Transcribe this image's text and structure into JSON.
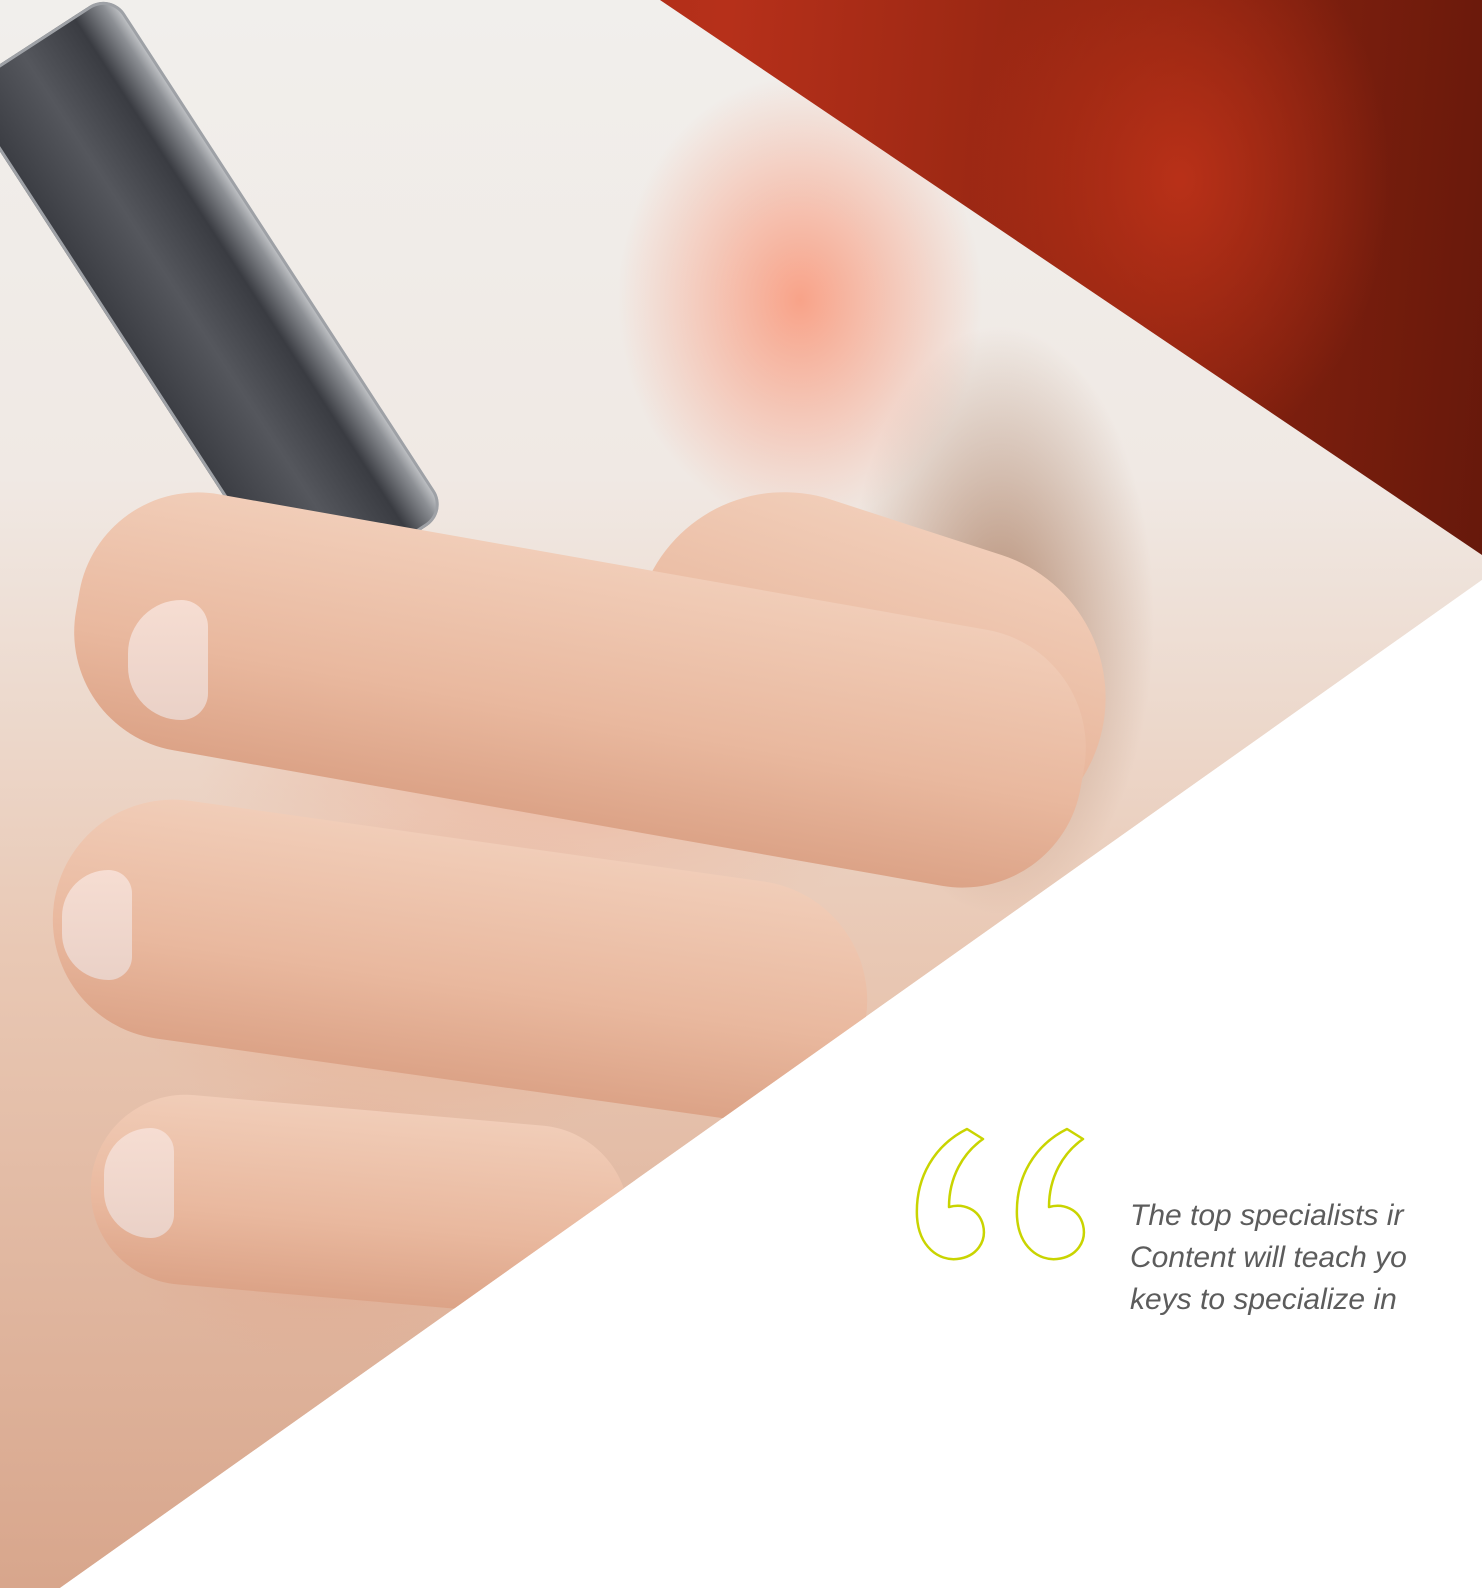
{
  "quote": {
    "icon": "quotation-mark-icon",
    "accent_color": "#c9d400",
    "lines": [
      "The top specialists ir",
      "Content will teach yo",
      "keys to specialize in"
    ]
  },
  "colors": {
    "red_band": "#a82a14",
    "text": "#5c5c5c",
    "background": "#ffffff"
  }
}
